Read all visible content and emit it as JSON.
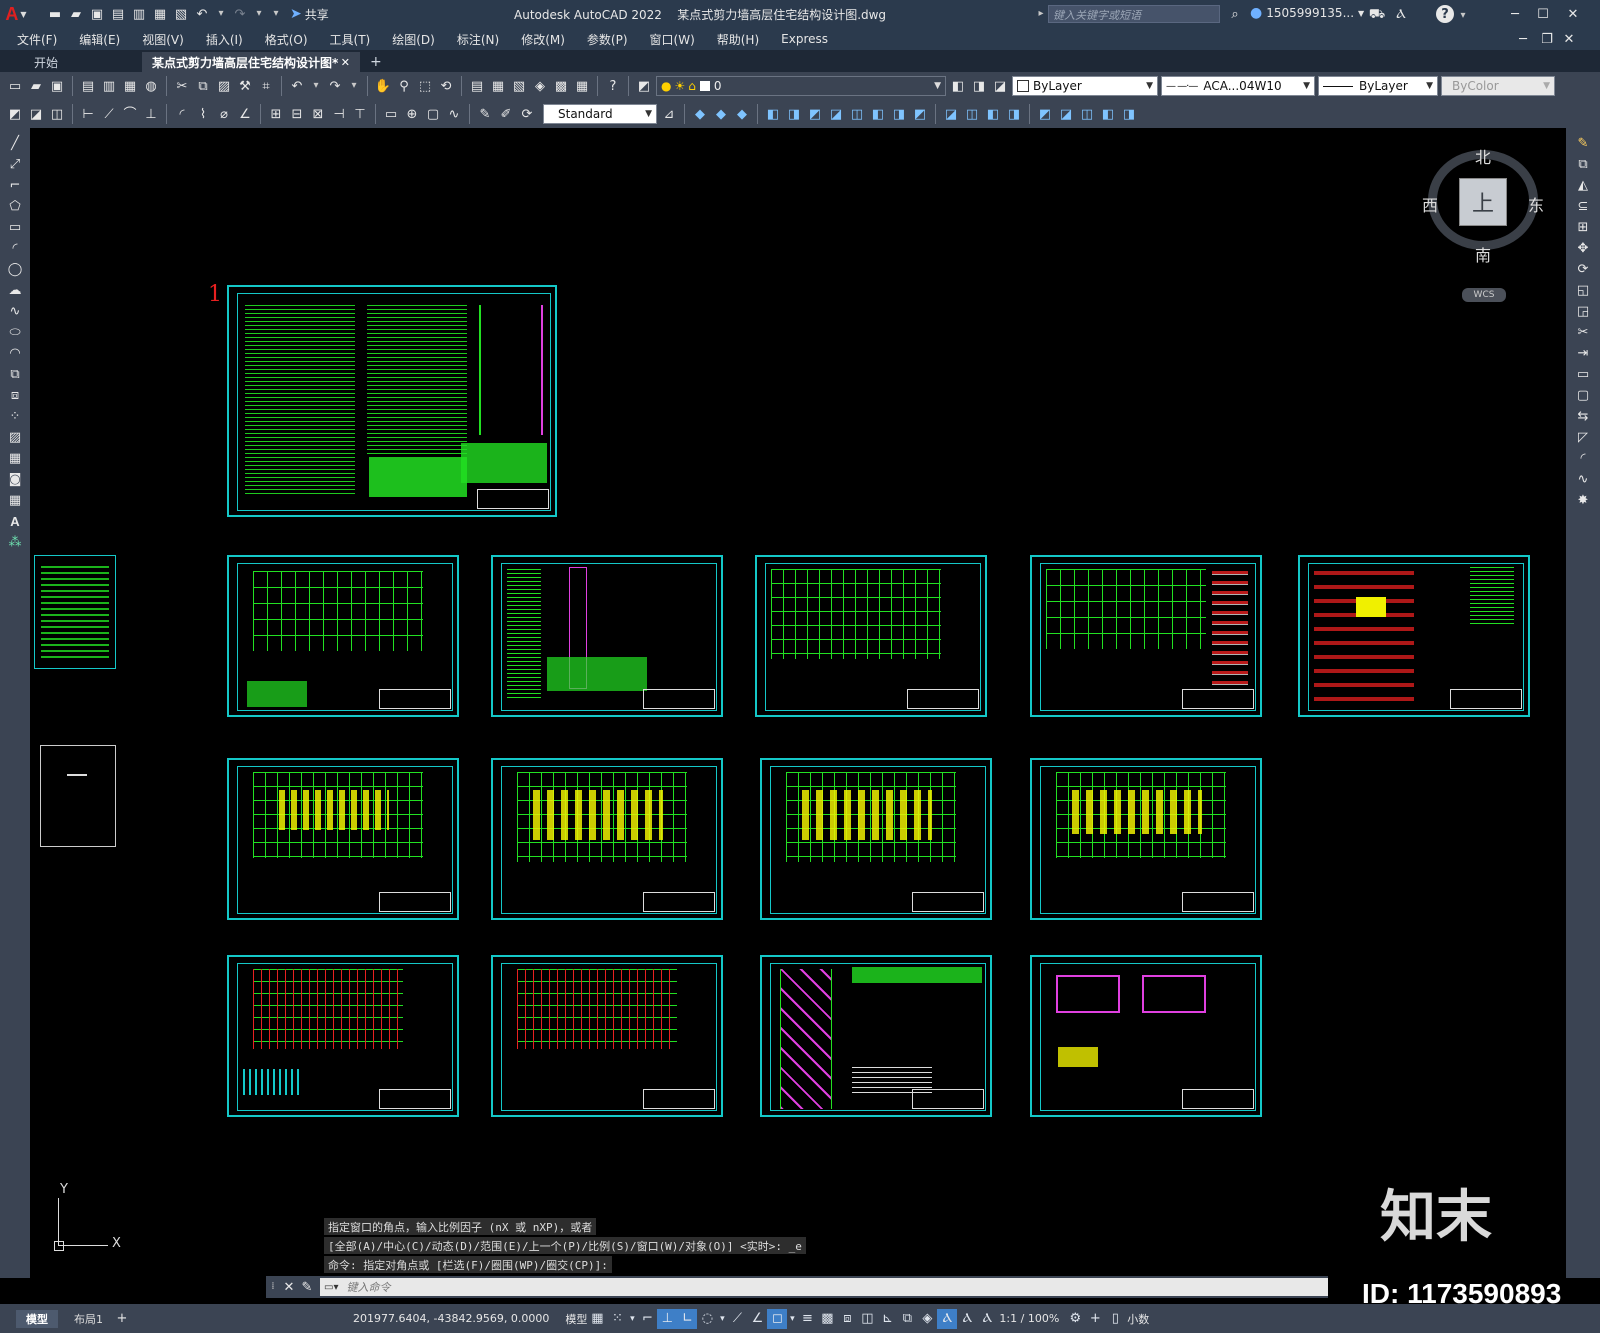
{
  "titlebar": {
    "app_title": "Autodesk AutoCAD 2022",
    "document_title": "某点式剪力墙高层住宅结构设计图.dwg",
    "share_label": "共享",
    "search_placeholder": "键入关键字或短语",
    "user_name": "1505999135..."
  },
  "menubar": {
    "items": [
      "文件(F)",
      "编辑(E)",
      "视图(V)",
      "插入(I)",
      "格式(O)",
      "工具(T)",
      "绘图(D)",
      "标注(N)",
      "修改(M)",
      "参数(P)",
      "窗口(W)",
      "帮助(H)",
      "Express"
    ]
  },
  "tabs": {
    "start": "开始",
    "active": "某点式剪力墙高层住宅结构设计图*",
    "close": "✕",
    "add": "+"
  },
  "toolbar1": {
    "layer_value": "0",
    "color_value": "ByLayer",
    "linetype_value": "ACA...04W10",
    "lineweight_value": "ByLayer",
    "plotstyle_value": "ByColor"
  },
  "toolbar2": {
    "textstyle_value": "Standard"
  },
  "viewcube": {
    "north": "北",
    "south": "南",
    "east": "东",
    "west": "西",
    "face": "上",
    "wcs": "WCS"
  },
  "canvas": {
    "sheet_number": "1",
    "ucs_x": "X",
    "ucs_y": "Y"
  },
  "command": {
    "history_1": "指定窗口的角点，输入比例因子 (nX 或 nXP)，或者",
    "history_2": "[全部(A)/中心(C)/动态(D)/范围(E)/上一个(P)/比例(S)/窗口(W)/对象(O)] <实时>: _e",
    "history_3": "命令: 指定对角点或 [栏选(F)/圈围(WP)/圈交(CP)]:",
    "input_placeholder": "键入命令"
  },
  "layout_tabs": [
    "模型",
    "布局1"
  ],
  "statusbar": {
    "coordinates": "201977.6404, -43842.9569, 0.0000",
    "model_label": "模型",
    "scale_label": "1:1 / 100%",
    "units_label": "小数"
  },
  "watermark": {
    "brand": "知末",
    "id_label": "ID: 1173590893"
  },
  "colors": {
    "ui_dark": "#2b3a4d",
    "ui_panel": "#3b4453",
    "canvas": "#000000",
    "sheet_border": "#14c8c8",
    "drawing_green": "#22e022",
    "drawing_yellow": "#f0f000",
    "drawing_red": "#e82020",
    "drawing_magenta": "#e040e0"
  }
}
